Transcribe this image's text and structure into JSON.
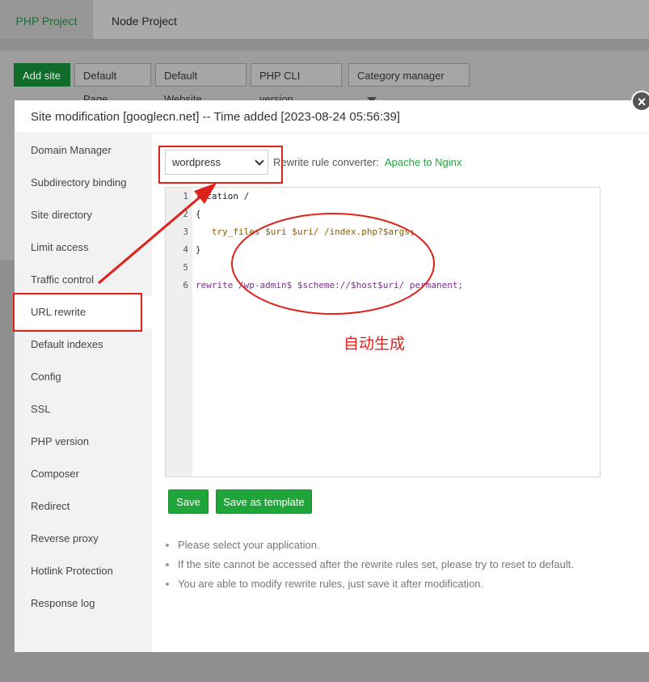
{
  "top_tabs": [
    {
      "label": "PHP Project",
      "active": true
    },
    {
      "label": "Node Project",
      "active": false
    }
  ],
  "toolbar": {
    "add_site": "Add site",
    "default_page": "Default Page",
    "default_website": "Default Website",
    "php_cli_version": "PHP CLI version",
    "category_manager": "Category manager"
  },
  "modal": {
    "title": "Site modification [googlecn.net] -- Time added [2023-08-24 05:56:39]",
    "close_symbol": "×"
  },
  "sidebar": {
    "items": [
      {
        "label": "Domain Manager"
      },
      {
        "label": "Subdirectory binding"
      },
      {
        "label": "Site directory"
      },
      {
        "label": "Limit access"
      },
      {
        "label": "Traffic control"
      },
      {
        "label": "URL rewrite",
        "active": true
      },
      {
        "label": "Default indexes"
      },
      {
        "label": "Config"
      },
      {
        "label": "SSL"
      },
      {
        "label": "PHP version"
      },
      {
        "label": "Composer"
      },
      {
        "label": "Redirect"
      },
      {
        "label": "Reverse proxy"
      },
      {
        "label": "Hotlink Protection"
      },
      {
        "label": "Response log"
      }
    ]
  },
  "rewrite": {
    "selected_app": "wordpress",
    "converter_label": "Rewrite rule converter:",
    "converter_link": "Apache to Nginx",
    "code_lines": [
      {
        "n": "1",
        "text": "location /"
      },
      {
        "n": "2",
        "text": "{"
      },
      {
        "n": "3",
        "text": "   try_files $uri $uri/ /index.php?$args;"
      },
      {
        "n": "4",
        "text": "}"
      },
      {
        "n": "5",
        "text": ""
      },
      {
        "n": "6",
        "text": "rewrite /wp-admin$ $scheme://$host$uri/ permanent;"
      }
    ],
    "save": "Save",
    "save_as_template": "Save as template",
    "tips": [
      "Please select your application.",
      "If the site cannot be accessed after the rewrite rules set, please try to reset to default.",
      "You are able to modify rewrite rules, just save it after modification."
    ]
  },
  "annotation": {
    "text": "自动生成",
    "color": "#e0211b"
  },
  "colors": {
    "accent_green": "#20a53a",
    "annotation_red": "#e0211b"
  }
}
